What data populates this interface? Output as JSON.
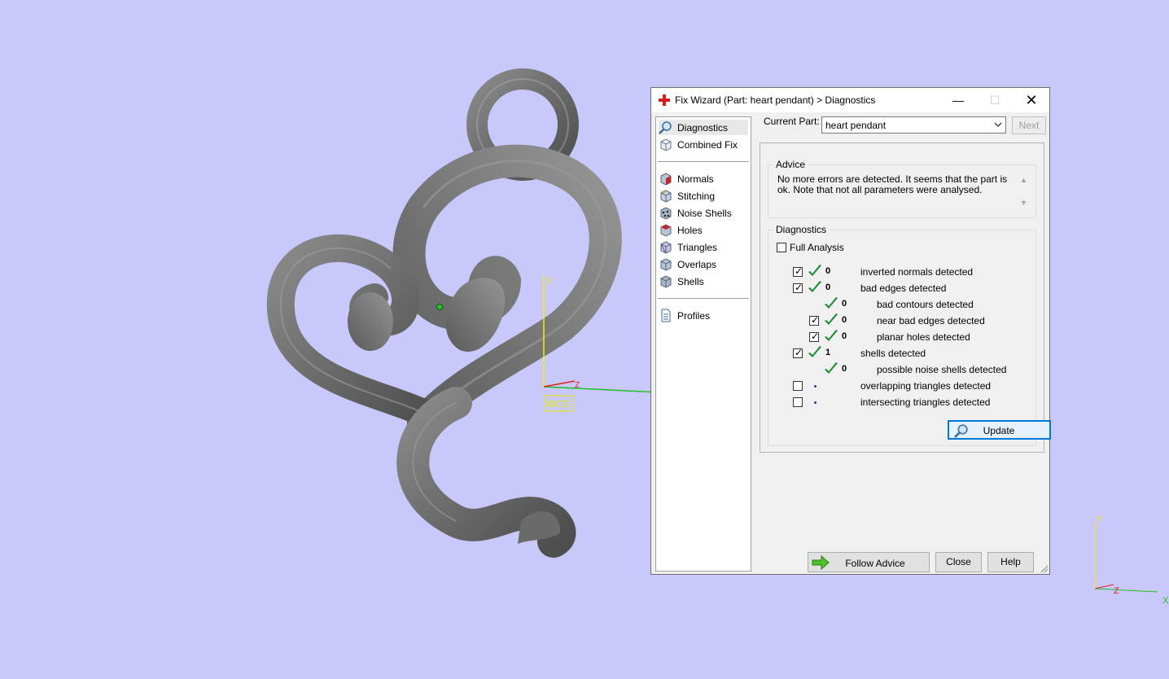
{
  "viewport": {
    "wcs_label": "WCS",
    "axis_y": "Y",
    "axis_z": "Z",
    "mini_axis_y": "Y",
    "mini_axis_z": "Z",
    "mini_axis_x": "X"
  },
  "dialog": {
    "title": "Fix Wizard (Part: heart pendant) > Diagnostics",
    "nav": {
      "top": [
        {
          "label": "Diagnostics",
          "icon": "magnifier-icon",
          "selected": true
        },
        {
          "label": "Combined Fix",
          "icon": "cube-icon"
        }
      ],
      "middle": [
        {
          "label": "Normals",
          "icon": "normals-cube-icon"
        },
        {
          "label": "Stitching",
          "icon": "stitching-cube-icon"
        },
        {
          "label": "Noise Shells",
          "icon": "noise-shells-icon"
        },
        {
          "label": "Holes",
          "icon": "holes-cube-icon"
        },
        {
          "label": "Triangles",
          "icon": "triangles-cube-icon"
        },
        {
          "label": "Overlaps",
          "icon": "overlaps-cube-icon"
        },
        {
          "label": "Shells",
          "icon": "shells-cube-icon"
        }
      ],
      "bottom": [
        {
          "label": "Profiles",
          "icon": "document-icon"
        }
      ]
    },
    "current_part_label": "Current Part:",
    "current_part_value": "heart pendant",
    "next_label": "Next",
    "advice": {
      "title": "Advice",
      "text": "No more errors are detected. It seems that the part is ok. Note that not all parameters were analysed."
    },
    "diagnostics": {
      "title": "Diagnostics",
      "full_analysis_label": "Full Analysis",
      "full_analysis_checked": false,
      "rows": [
        {
          "checkbox": true,
          "checked": true,
          "status": "ok",
          "count": "0",
          "label": "inverted normals detected",
          "indent": 0
        },
        {
          "checkbox": true,
          "checked": true,
          "status": "ok",
          "count": "0",
          "label": "bad edges detected",
          "indent": 0
        },
        {
          "checkbox": false,
          "checked": false,
          "status": "ok",
          "count": "0",
          "label": "bad contours detected",
          "indent": 1
        },
        {
          "checkbox": true,
          "checked": true,
          "status": "ok",
          "count": "0",
          "label": "near bad edges detected",
          "indent": 1
        },
        {
          "checkbox": true,
          "checked": true,
          "status": "ok",
          "count": "0",
          "label": "planar holes detected",
          "indent": 1
        },
        {
          "checkbox": true,
          "checked": true,
          "status": "ok",
          "count": "1",
          "label": "shells detected",
          "indent": 0
        },
        {
          "checkbox": false,
          "checked": false,
          "status": "ok",
          "count": "0",
          "label": "possible noise shells detected",
          "indent": 1
        },
        {
          "checkbox": true,
          "checked": false,
          "status": "pending",
          "count": "",
          "label": "overlapping triangles detected",
          "indent": 0
        },
        {
          "checkbox": true,
          "checked": false,
          "status": "pending",
          "count": "",
          "label": "intersecting triangles detected",
          "indent": 0
        }
      ],
      "update_label": "Update"
    },
    "follow_advice_label": "Follow Advice",
    "close_label": "Close",
    "help_label": "Help"
  },
  "colors": {
    "background": "#c8c8fa",
    "check_green": "#1f8a2e",
    "accent_blue": "#0078d7",
    "title_icon_red": "#d42020"
  }
}
